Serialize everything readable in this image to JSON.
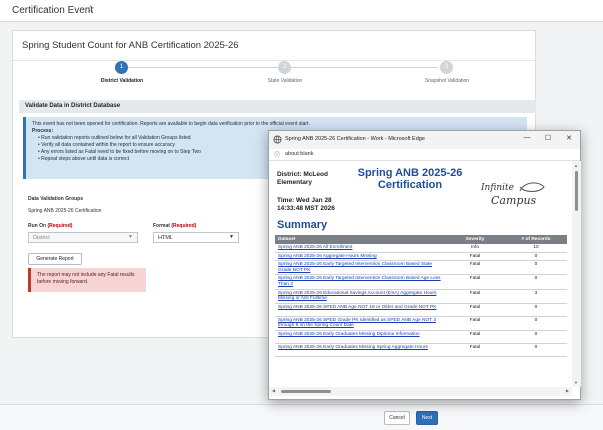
{
  "page": {
    "title": "Certification Event"
  },
  "card": {
    "title": "Spring Student Count for ANB Certification 2025-26"
  },
  "steps": [
    {
      "number": "1",
      "label": "District Validation"
    },
    {
      "number": "2",
      "label": "State Validation"
    },
    {
      "number": "3",
      "label": "Snapshot Validation"
    }
  ],
  "section": {
    "title": "Validate Data in District Database"
  },
  "info": {
    "intro": "This event has not been opened for certification. Reports are available to begin data verification prior to the official event start.",
    "process_label": "Process:",
    "bullets": [
      "Run validation reports outlined below for all Validation Groups listed",
      "Verify all data contained within the report to ensure accuracy",
      "Any errors listed as Fatal need to be fixed before moving on to Step Two",
      "Repeat steps above until data is correct"
    ]
  },
  "groups": {
    "heading": "Data Validation Groups",
    "value": "Spring ANB 2025-26 Certification"
  },
  "run_on": {
    "label": "Run On ",
    "required": "(Required)",
    "value": "District"
  },
  "format": {
    "label": "Format ",
    "required": "(Required)",
    "value": "HTML"
  },
  "buttons": {
    "generate": "Generate Report",
    "cancel": "Cancel",
    "next": "Next"
  },
  "warning": {
    "text": "The report may not include any Fatal results before moving forward."
  },
  "popup": {
    "window_title": "Spring ANB 2025-26 Certification - Work - Microsoft Edge",
    "controls": {
      "minimize": "—",
      "maximize": "☐",
      "close": "✕"
    },
    "url": "about:blank",
    "district": "District: McLeod Elementary",
    "time": "Time: Wed Jan 28 14:33:48 MST 2026",
    "report_title": "Spring ANB 2025-26 Certification",
    "logo": {
      "line1": "Infinite",
      "line2": "Campus"
    },
    "summary": "Summary",
    "table": {
      "headers": [
        "Dataset",
        "Severity",
        "# of Records"
      ],
      "rows": [
        {
          "dataset": "Spring ANB 2025-26 All Enrollment",
          "severity": "Info",
          "records": "10"
        },
        {
          "dataset": "Spring ANB 2025-26 Aggregate Hours Missing",
          "severity": "Fatal",
          "records": "0"
        },
        {
          "dataset": "Spring ANB 2025-26 Early Targeted Intervention Classroom Based State Grade NOT PK",
          "severity": "Fatal",
          "records": "0"
        },
        {
          "dataset": "Spring ANB 2025-26 Early Targeted Intervention Classroom Based Age Less Than 4",
          "severity": "Fatal",
          "records": "0"
        },
        {
          "dataset": "Spring ANB 2025-26 Educational Savings Account (ESA) Aggregate Hours Missing or Not Fulltime",
          "severity": "Fatal",
          "records": "3"
        },
        {
          "dataset": "Spring ANB 2025-26 SPED ANB Age NOT 18 or Older and Grade NOT PK",
          "severity": "Fatal",
          "records": "0"
        },
        {
          "dataset": "Spring ANB 2025-26 SPED Grade PK Identified as SPED ANB Age NOT 3 through 6 on the Spring Count Date",
          "severity": "Fatal",
          "records": "0"
        },
        {
          "dataset": "Spring ANB 2025-26 Early Graduates Missing Diploma Information",
          "severity": "Fatal",
          "records": "0"
        },
        {
          "dataset": "Spring ANB 2025-26 Early Graduates Missing Spring Aggregate Hours",
          "severity": "Fatal",
          "records": "0"
        }
      ]
    }
  }
}
